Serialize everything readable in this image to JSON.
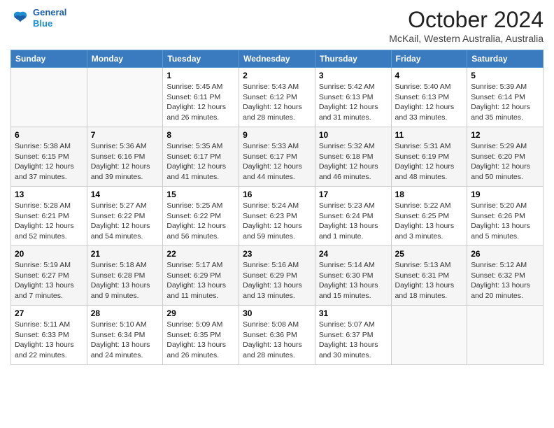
{
  "header": {
    "logo_line1": "General",
    "logo_line2": "Blue",
    "month": "October 2024",
    "location": "McKail, Western Australia, Australia"
  },
  "weekdays": [
    "Sunday",
    "Monday",
    "Tuesday",
    "Wednesday",
    "Thursday",
    "Friday",
    "Saturday"
  ],
  "weeks": [
    [
      {
        "day": "",
        "sunrise": "",
        "sunset": "",
        "daylight": ""
      },
      {
        "day": "",
        "sunrise": "",
        "sunset": "",
        "daylight": ""
      },
      {
        "day": "1",
        "sunrise": "Sunrise: 5:45 AM",
        "sunset": "Sunset: 6:11 PM",
        "daylight": "Daylight: 12 hours and 26 minutes."
      },
      {
        "day": "2",
        "sunrise": "Sunrise: 5:43 AM",
        "sunset": "Sunset: 6:12 PM",
        "daylight": "Daylight: 12 hours and 28 minutes."
      },
      {
        "day": "3",
        "sunrise": "Sunrise: 5:42 AM",
        "sunset": "Sunset: 6:13 PM",
        "daylight": "Daylight: 12 hours and 31 minutes."
      },
      {
        "day": "4",
        "sunrise": "Sunrise: 5:40 AM",
        "sunset": "Sunset: 6:13 PM",
        "daylight": "Daylight: 12 hours and 33 minutes."
      },
      {
        "day": "5",
        "sunrise": "Sunrise: 5:39 AM",
        "sunset": "Sunset: 6:14 PM",
        "daylight": "Daylight: 12 hours and 35 minutes."
      }
    ],
    [
      {
        "day": "6",
        "sunrise": "Sunrise: 5:38 AM",
        "sunset": "Sunset: 6:15 PM",
        "daylight": "Daylight: 12 hours and 37 minutes."
      },
      {
        "day": "7",
        "sunrise": "Sunrise: 5:36 AM",
        "sunset": "Sunset: 6:16 PM",
        "daylight": "Daylight: 12 hours and 39 minutes."
      },
      {
        "day": "8",
        "sunrise": "Sunrise: 5:35 AM",
        "sunset": "Sunset: 6:17 PM",
        "daylight": "Daylight: 12 hours and 41 minutes."
      },
      {
        "day": "9",
        "sunrise": "Sunrise: 5:33 AM",
        "sunset": "Sunset: 6:17 PM",
        "daylight": "Daylight: 12 hours and 44 minutes."
      },
      {
        "day": "10",
        "sunrise": "Sunrise: 5:32 AM",
        "sunset": "Sunset: 6:18 PM",
        "daylight": "Daylight: 12 hours and 46 minutes."
      },
      {
        "day": "11",
        "sunrise": "Sunrise: 5:31 AM",
        "sunset": "Sunset: 6:19 PM",
        "daylight": "Daylight: 12 hours and 48 minutes."
      },
      {
        "day": "12",
        "sunrise": "Sunrise: 5:29 AM",
        "sunset": "Sunset: 6:20 PM",
        "daylight": "Daylight: 12 hours and 50 minutes."
      }
    ],
    [
      {
        "day": "13",
        "sunrise": "Sunrise: 5:28 AM",
        "sunset": "Sunset: 6:21 PM",
        "daylight": "Daylight: 12 hours and 52 minutes."
      },
      {
        "day": "14",
        "sunrise": "Sunrise: 5:27 AM",
        "sunset": "Sunset: 6:22 PM",
        "daylight": "Daylight: 12 hours and 54 minutes."
      },
      {
        "day": "15",
        "sunrise": "Sunrise: 5:25 AM",
        "sunset": "Sunset: 6:22 PM",
        "daylight": "Daylight: 12 hours and 56 minutes."
      },
      {
        "day": "16",
        "sunrise": "Sunrise: 5:24 AM",
        "sunset": "Sunset: 6:23 PM",
        "daylight": "Daylight: 12 hours and 59 minutes."
      },
      {
        "day": "17",
        "sunrise": "Sunrise: 5:23 AM",
        "sunset": "Sunset: 6:24 PM",
        "daylight": "Daylight: 13 hours and 1 minute."
      },
      {
        "day": "18",
        "sunrise": "Sunrise: 5:22 AM",
        "sunset": "Sunset: 6:25 PM",
        "daylight": "Daylight: 13 hours and 3 minutes."
      },
      {
        "day": "19",
        "sunrise": "Sunrise: 5:20 AM",
        "sunset": "Sunset: 6:26 PM",
        "daylight": "Daylight: 13 hours and 5 minutes."
      }
    ],
    [
      {
        "day": "20",
        "sunrise": "Sunrise: 5:19 AM",
        "sunset": "Sunset: 6:27 PM",
        "daylight": "Daylight: 13 hours and 7 minutes."
      },
      {
        "day": "21",
        "sunrise": "Sunrise: 5:18 AM",
        "sunset": "Sunset: 6:28 PM",
        "daylight": "Daylight: 13 hours and 9 minutes."
      },
      {
        "day": "22",
        "sunrise": "Sunrise: 5:17 AM",
        "sunset": "Sunset: 6:29 PM",
        "daylight": "Daylight: 13 hours and 11 minutes."
      },
      {
        "day": "23",
        "sunrise": "Sunrise: 5:16 AM",
        "sunset": "Sunset: 6:29 PM",
        "daylight": "Daylight: 13 hours and 13 minutes."
      },
      {
        "day": "24",
        "sunrise": "Sunrise: 5:14 AM",
        "sunset": "Sunset: 6:30 PM",
        "daylight": "Daylight: 13 hours and 15 minutes."
      },
      {
        "day": "25",
        "sunrise": "Sunrise: 5:13 AM",
        "sunset": "Sunset: 6:31 PM",
        "daylight": "Daylight: 13 hours and 18 minutes."
      },
      {
        "day": "26",
        "sunrise": "Sunrise: 5:12 AM",
        "sunset": "Sunset: 6:32 PM",
        "daylight": "Daylight: 13 hours and 20 minutes."
      }
    ],
    [
      {
        "day": "27",
        "sunrise": "Sunrise: 5:11 AM",
        "sunset": "Sunset: 6:33 PM",
        "daylight": "Daylight: 13 hours and 22 minutes."
      },
      {
        "day": "28",
        "sunrise": "Sunrise: 5:10 AM",
        "sunset": "Sunset: 6:34 PM",
        "daylight": "Daylight: 13 hours and 24 minutes."
      },
      {
        "day": "29",
        "sunrise": "Sunrise: 5:09 AM",
        "sunset": "Sunset: 6:35 PM",
        "daylight": "Daylight: 13 hours and 26 minutes."
      },
      {
        "day": "30",
        "sunrise": "Sunrise: 5:08 AM",
        "sunset": "Sunset: 6:36 PM",
        "daylight": "Daylight: 13 hours and 28 minutes."
      },
      {
        "day": "31",
        "sunrise": "Sunrise: 5:07 AM",
        "sunset": "Sunset: 6:37 PM",
        "daylight": "Daylight: 13 hours and 30 minutes."
      },
      {
        "day": "",
        "sunrise": "",
        "sunset": "",
        "daylight": ""
      },
      {
        "day": "",
        "sunrise": "",
        "sunset": "",
        "daylight": ""
      }
    ]
  ]
}
